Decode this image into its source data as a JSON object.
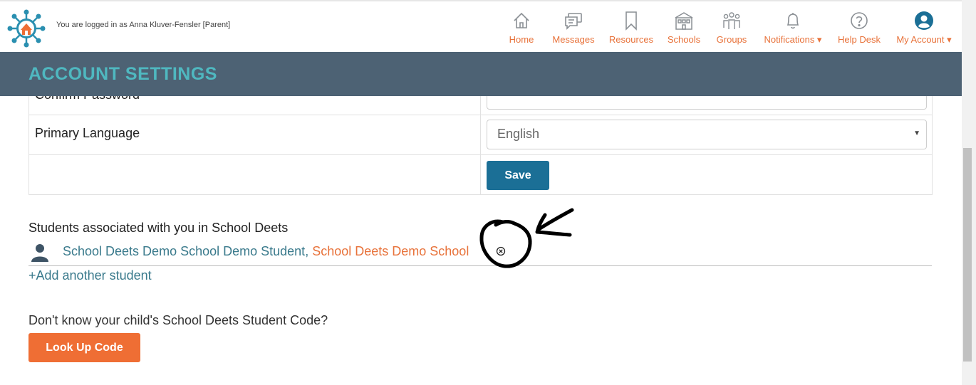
{
  "header": {
    "logged_in_text": "You are logged in as Anna Kluver-Fensler [Parent]",
    "nav": [
      {
        "label": "Home",
        "icon": "home-icon"
      },
      {
        "label": "Messages",
        "icon": "messages-icon"
      },
      {
        "label": "Resources",
        "icon": "bookmark-icon"
      },
      {
        "label": "Schools",
        "icon": "school-icon"
      },
      {
        "label": "Groups",
        "icon": "groups-icon"
      },
      {
        "label": "Notifications ▾",
        "icon": "bell-icon"
      },
      {
        "label": "Help Desk",
        "icon": "help-icon"
      },
      {
        "label": "My Account ▾",
        "icon": "account-icon"
      }
    ]
  },
  "page": {
    "title": "ACCOUNT SETTINGS"
  },
  "form": {
    "confirm_password_label": "Confirm Password",
    "primary_language_label": "Primary Language",
    "primary_language_value": "English",
    "save_label": "Save"
  },
  "students": {
    "heading": "Students associated with you in School Deets",
    "student_name": "School Deets Demo School Demo Student",
    "separator": ", ",
    "school_name": "School Deets Demo School",
    "add_label": "+Add another student"
  },
  "lookup": {
    "prompt": "Don't know your child's School Deets Student Code?",
    "button_label": "Look Up Code"
  },
  "colors": {
    "accent_orange": "#e8723a",
    "band_bg": "#4d6274",
    "title_teal": "#4fb8c0",
    "save_blue": "#1b6f96"
  }
}
